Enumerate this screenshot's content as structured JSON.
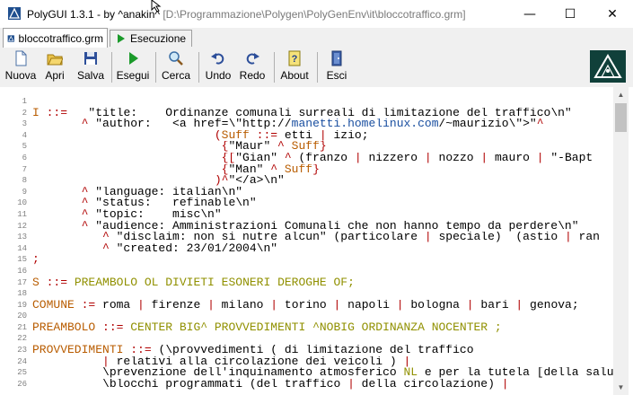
{
  "window": {
    "title_app": "PolyGUI 1.3.1 - by ^anakin^",
    "title_path": "[D:\\Programmazione\\Polygen\\PolyGenEnv\\it\\bloccotraffico.grm]",
    "minimize": "—",
    "maximize": "☐",
    "close": "✕"
  },
  "tabs": [
    {
      "label": "bloccotraffico.grm",
      "icon": "grammar-file-icon",
      "active": true
    },
    {
      "label": "Esecuzione",
      "icon": "run-arrow-icon",
      "active": false
    }
  ],
  "toolbar": {
    "items": [
      {
        "label": "Nuova",
        "icon": "new-file-icon"
      },
      {
        "label": "Apri",
        "icon": "open-folder-icon"
      },
      {
        "label": "Salva",
        "icon": "save-disk-icon"
      },
      {
        "label": "Esegui",
        "icon": "play-icon"
      },
      {
        "label": "Cerca",
        "icon": "magnifier-icon"
      },
      {
        "label": "Undo",
        "icon": "undo-arrow-icon"
      },
      {
        "label": "Redo",
        "icon": "redo-arrow-icon"
      },
      {
        "label": "About",
        "icon": "help-question-icon"
      },
      {
        "label": "Esci",
        "icon": "exit-door-icon"
      }
    ],
    "colors": {
      "accent_logo_bg": "#10403a"
    }
  },
  "editor": {
    "lines": [
      {
        "n": "1",
        "segs": []
      },
      {
        "n": "2",
        "segs": [
          [
            "kw",
            "I"
          ],
          [
            "op",
            " ::="
          ],
          [
            "str",
            "   \"title:    Ordinanze comunali surreali di limitazione del traffico\\n\""
          ]
        ]
      },
      {
        "n": "3",
        "segs": [
          [
            "op",
            "       ^"
          ],
          [
            "str",
            " \"author:   <a href=\\\"http://"
          ],
          [
            "lnk",
            "manetti.homelinux.com"
          ],
          [
            "str",
            "/~maurizio\\\">\""
          ],
          [
            "op",
            "^"
          ]
        ]
      },
      {
        "n": "4",
        "segs": [
          [
            "op",
            "                          ("
          ],
          [
            "kw",
            "Suff"
          ],
          [
            "op",
            " ::="
          ],
          [
            "str",
            " etti "
          ],
          [
            "op",
            "|"
          ],
          [
            "str",
            " izio;"
          ]
        ]
      },
      {
        "n": "5",
        "segs": [
          [
            "op",
            "                           {"
          ],
          [
            "str",
            "\"Maur\" "
          ],
          [
            "op",
            "^"
          ],
          [
            "kw",
            " Suff"
          ],
          [
            "op",
            "}"
          ]
        ]
      },
      {
        "n": "6",
        "segs": [
          [
            "op",
            "                           {["
          ],
          [
            "str",
            "\"Gian\" "
          ],
          [
            "op",
            "^"
          ],
          [
            "str",
            " (franzo "
          ],
          [
            "op",
            "|"
          ],
          [
            "str",
            " nizzero "
          ],
          [
            "op",
            "|"
          ],
          [
            "str",
            " nozzo "
          ],
          [
            "op",
            "|"
          ],
          [
            "str",
            " mauro "
          ],
          [
            "op",
            "|"
          ],
          [
            "str",
            " \"-Bapt"
          ]
        ]
      },
      {
        "n": "7",
        "segs": [
          [
            "op",
            "                           {"
          ],
          [
            "str",
            "\"Man\" "
          ],
          [
            "op",
            "^"
          ],
          [
            "kw",
            " Suff"
          ],
          [
            "op",
            "}"
          ]
        ]
      },
      {
        "n": "8",
        "segs": [
          [
            "op",
            "                          )^"
          ],
          [
            "str",
            "\"</a>\\n\""
          ]
        ]
      },
      {
        "n": "9",
        "segs": [
          [
            "op",
            "       ^"
          ],
          [
            "str",
            " \"language: italian\\n\""
          ]
        ]
      },
      {
        "n": "10",
        "segs": [
          [
            "op",
            "       ^"
          ],
          [
            "str",
            " \"status:   refinable\\n\""
          ]
        ]
      },
      {
        "n": "11",
        "segs": [
          [
            "op",
            "       ^"
          ],
          [
            "str",
            " \"topic:    misc\\n\""
          ]
        ]
      },
      {
        "n": "12",
        "segs": [
          [
            "op",
            "       ^"
          ],
          [
            "str",
            " \"audience: Amministrazioni Comunali che non hanno tempo da perdere\\n\""
          ]
        ]
      },
      {
        "n": "13",
        "segs": [
          [
            "op",
            "          ^"
          ],
          [
            "str",
            " \"disclaim: non si nutre alcun\" (particolare "
          ],
          [
            "op",
            "|"
          ],
          [
            "str",
            " speciale)  (astio "
          ],
          [
            "op",
            "|"
          ],
          [
            "str",
            " ran"
          ]
        ]
      },
      {
        "n": "14",
        "segs": [
          [
            "op",
            "          ^"
          ],
          [
            "str",
            " \"created: 23/01/2004\\n\""
          ]
        ]
      },
      {
        "n": "15",
        "segs": [
          [
            "op",
            ";"
          ]
        ]
      },
      {
        "n": "16",
        "segs": []
      },
      {
        "n": "17",
        "segs": [
          [
            "kw",
            "S"
          ],
          [
            "op",
            " ::="
          ],
          [
            "nt",
            " PREAMBOLO OL DIVIETI ESONERI DEROGHE OF;"
          ]
        ]
      },
      {
        "n": "18",
        "segs": []
      },
      {
        "n": "19",
        "segs": [
          [
            "kw",
            "COMUNE"
          ],
          [
            "op",
            " :="
          ],
          [
            "str",
            " roma "
          ],
          [
            "op",
            "|"
          ],
          [
            "str",
            " firenze "
          ],
          [
            "op",
            "|"
          ],
          [
            "str",
            " milano "
          ],
          [
            "op",
            "|"
          ],
          [
            "str",
            " torino "
          ],
          [
            "op",
            "|"
          ],
          [
            "str",
            " napoli "
          ],
          [
            "op",
            "|"
          ],
          [
            "str",
            " bologna "
          ],
          [
            "op",
            "|"
          ],
          [
            "str",
            " bari "
          ],
          [
            "op",
            "|"
          ],
          [
            "str",
            " genova;"
          ]
        ]
      },
      {
        "n": "20",
        "segs": []
      },
      {
        "n": "21",
        "segs": [
          [
            "kw",
            "PREAMBOLO"
          ],
          [
            "op",
            " ::="
          ],
          [
            "nt",
            " CENTER BIG^ PROVVEDIMENTI ^NOBIG ORDINANZA NOCENTER ;"
          ]
        ]
      },
      {
        "n": "22",
        "segs": []
      },
      {
        "n": "23",
        "segs": [
          [
            "kw",
            "PROVVEDIMENTI"
          ],
          [
            "op",
            " ::="
          ],
          [
            "str",
            " (\\provvedimenti ( di limitazione del traffico"
          ]
        ]
      },
      {
        "n": "24",
        "segs": [
          [
            "op",
            "          |"
          ],
          [
            "str",
            " relativi alla circolazione dei veicoli ) "
          ],
          [
            "op",
            "|"
          ]
        ]
      },
      {
        "n": "25",
        "segs": [
          [
            "str",
            "          \\prevenzione dell'inquinamento atmosferico "
          ],
          [
            "nt",
            "NL"
          ],
          [
            "str",
            " e per la tutela [della salu"
          ]
        ]
      },
      {
        "n": "26",
        "segs": [
          [
            "str",
            "          \\blocchi programmati (del traffico "
          ],
          [
            "op",
            "|"
          ],
          [
            "str",
            " della circolazione) "
          ],
          [
            "op",
            "|"
          ]
        ]
      }
    ]
  }
}
